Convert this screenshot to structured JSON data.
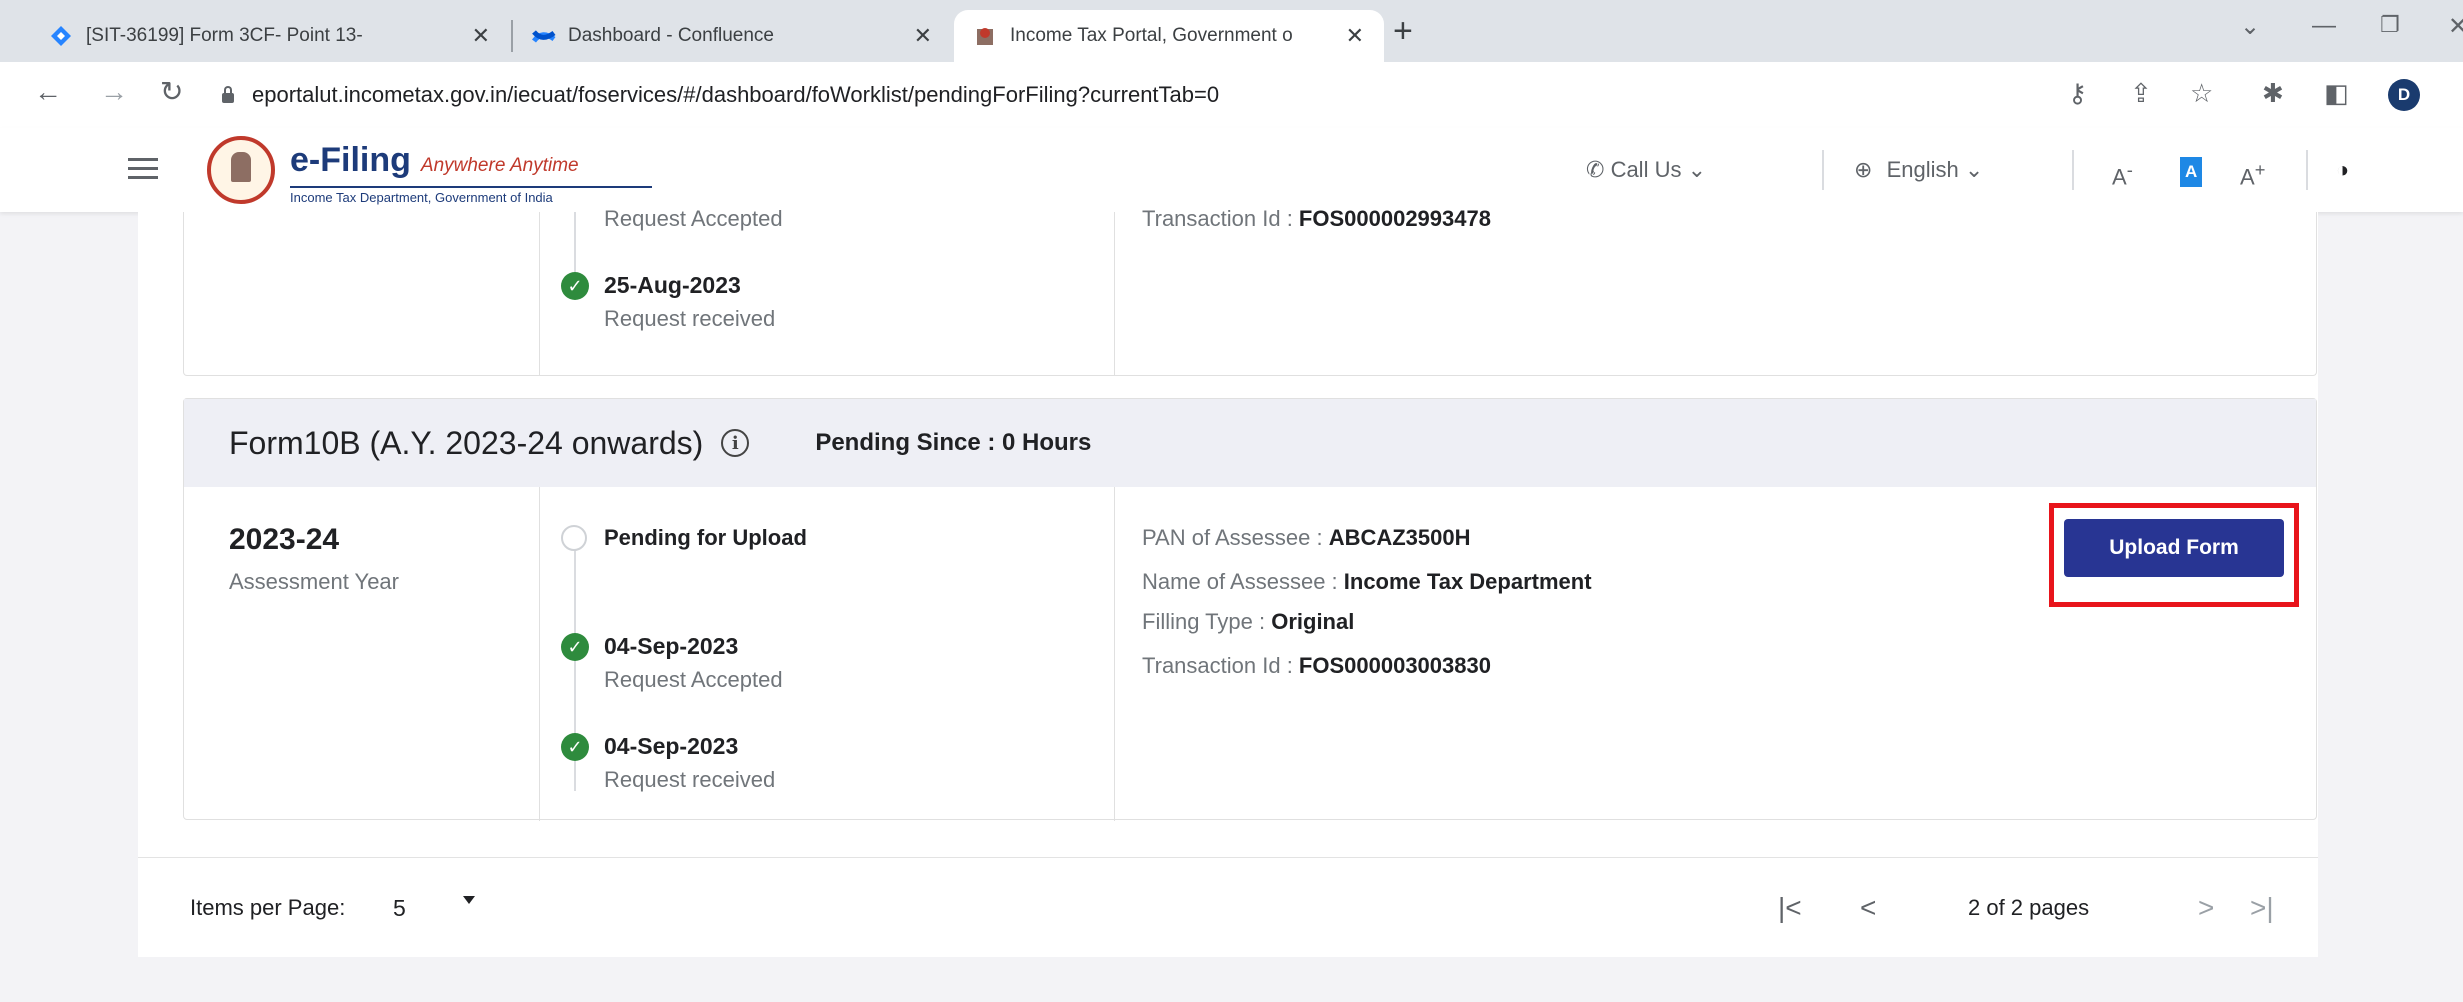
{
  "browser": {
    "tabs": [
      {
        "title": "[SIT-36199] Form 3CF- Point 13-",
        "active": false
      },
      {
        "title": "Dashboard - Confluence",
        "active": false
      },
      {
        "title": "Income Tax Portal, Government o",
        "active": true
      }
    ],
    "new_tab": "+",
    "url": "eportalut.incometax.gov.in/iecuat/foservices/#/dashboard/foWorklist/pendingForFiling?currentTab=0",
    "profile_initial": "D"
  },
  "header": {
    "brand": "e-Filing",
    "tagline": "Anywhere Anytime",
    "subtitle": "Income Tax Department, Government of India",
    "call_us": "Call Us",
    "language": "English",
    "font_decrease": "A",
    "font_default": "A",
    "font_increase": "A"
  },
  "previous_card": {
    "status_partial": "Request Accepted",
    "transaction_label": "Transaction Id : ",
    "transaction_value": "FOS000002993478",
    "received_date": "25-Aug-2023",
    "received_status": "Request received"
  },
  "form_card": {
    "title": "Form10B (A.Y. 2023-24 onwards)",
    "pending_since": "Pending Since : 0 Hours",
    "assessment_year": "2023-24",
    "assessment_year_label": "Assessment Year",
    "timeline": [
      {
        "date": "",
        "status": "Pending for Upload",
        "done": false
      },
      {
        "date": "04-Sep-2023",
        "status": "Request Accepted",
        "done": true
      },
      {
        "date": "04-Sep-2023",
        "status": "Request received",
        "done": true
      }
    ],
    "pan_label": "PAN of Assessee : ",
    "pan_value": "ABCAZ3500H",
    "name_label": "Name of Assessee : ",
    "name_value": "Income Tax Department",
    "filing_type_label": "Filling Type : ",
    "filing_type_value": "Original",
    "transaction_label": "Transaction Id : ",
    "transaction_value": "FOS000003003830",
    "upload_button": "Upload Form"
  },
  "pagination": {
    "items_per_page_label": "Items per Page:",
    "items_per_page_value": "5",
    "page_info": "2 of 2 pages"
  },
  "colors": {
    "upload_button": "#283593",
    "highlight": "#e8141b",
    "check": "#2e8b3d",
    "brand": "#1d3b7a"
  }
}
